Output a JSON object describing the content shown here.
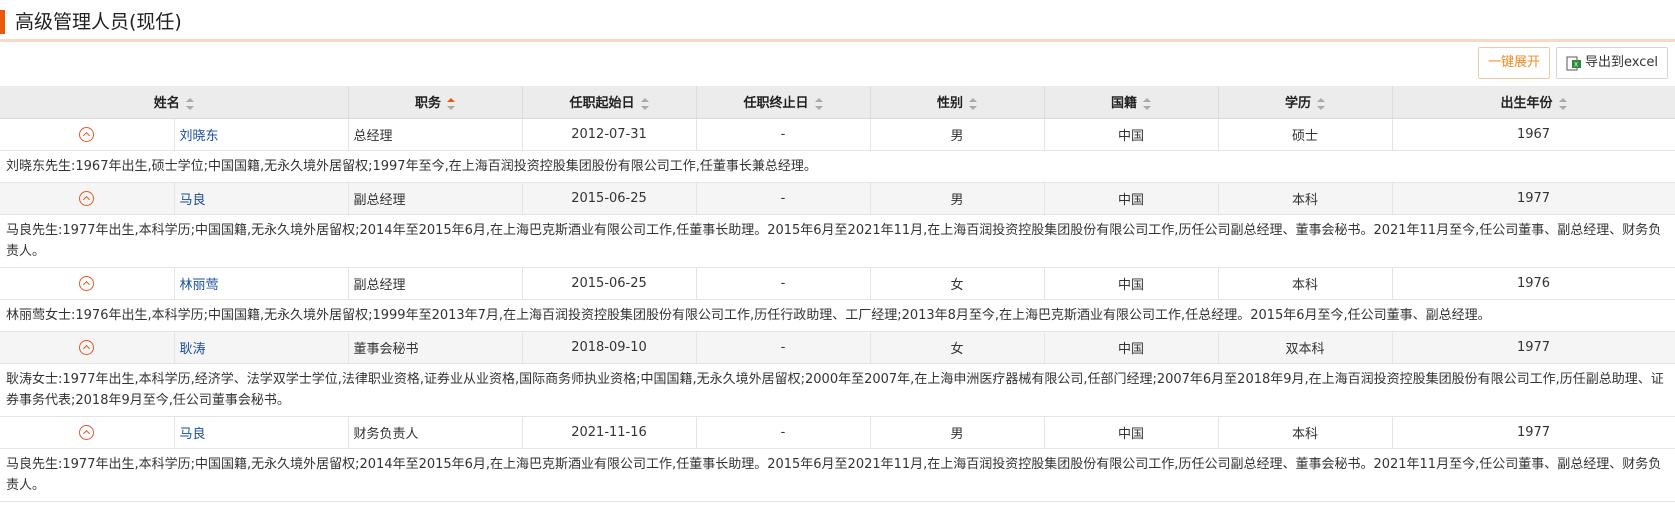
{
  "header": {
    "title": "高级管理人员(现任)"
  },
  "toolbar": {
    "expand_label": "一键展开",
    "export_label": "导出到excel"
  },
  "table": {
    "columns": [
      "姓名",
      "职务",
      "任职起始日",
      "任职终止日",
      "性别",
      "国籍",
      "学历",
      "出生年份"
    ],
    "sorted_column": "职务",
    "rows": [
      {
        "name": "刘晓东",
        "position": "总经理",
        "start": "2012-07-31",
        "end": "-",
        "gender": "男",
        "nationality": "中国",
        "education": "硕士",
        "birth_year": "1967",
        "bio": "刘晓东先生:1967年出生,硕士学位;中国国籍,无永久境外居留权;1997年至今,在上海百润投资控股集团股份有限公司工作,任董事长兼总经理。"
      },
      {
        "name": "马良",
        "position": "副总经理",
        "start": "2015-06-25",
        "end": "-",
        "gender": "男",
        "nationality": "中国",
        "education": "本科",
        "birth_year": "1977",
        "bio": "马良先生:1977年出生,本科学历;中国国籍,无永久境外居留权;2014年至2015年6月,在上海巴克斯酒业有限公司工作,任董事长助理。2015年6月至2021年11月,在上海百润投资控股集团股份有限公司工作,历任公司副总经理、董事会秘书。2021年11月至今,任公司董事、副总经理、财务负责人。"
      },
      {
        "name": "林丽莺",
        "position": "副总经理",
        "start": "2015-06-25",
        "end": "-",
        "gender": "女",
        "nationality": "中国",
        "education": "本科",
        "birth_year": "1976",
        "bio": "林丽莺女士:1976年出生,本科学历;中国国籍,无永久境外居留权;1999年至2013年7月,在上海百润投资控股集团股份有限公司工作,历任行政助理、工厂经理;2013年8月至今,在上海巴克斯酒业有限公司工作,任总经理。2015年6月至今,任公司董事、副总经理。"
      },
      {
        "name": "耿涛",
        "position": "董事会秘书",
        "start": "2018-09-10",
        "end": "-",
        "gender": "女",
        "nationality": "中国",
        "education": "双本科",
        "birth_year": "1977",
        "bio": "耿涛女士:1977年出生,本科学历,经济学、法学双学士学位,法律职业资格,证券业从业资格,国际商务师执业资格;中国国籍,无永久境外居留权;2000年至2007年,在上海申洲医疗器械有限公司,任部门经理;2007年6月至2018年9月,在上海百润投资控股集团股份有限公司工作,历任副总助理、证券事务代表;2018年9月至今,任公司董事会秘书。"
      },
      {
        "name": "马良",
        "position": "财务负责人",
        "start": "2021-11-16",
        "end": "-",
        "gender": "男",
        "nationality": "中国",
        "education": "本科",
        "birth_year": "1977",
        "bio": "马良先生:1977年出生,本科学历;中国国籍,无永久境外居留权;2014年至2015年6月,在上海巴克斯酒业有限公司工作,任董事长助理。2015年6月至2021年11月,在上海百润投资控股集团股份有限公司工作,历任公司副总经理、董事会秘书。2021年11月至今,任公司董事、副总经理、财务负责人。"
      }
    ]
  },
  "colors": {
    "accent": "#e8590c",
    "name_link": "#1a4e9c",
    "expand_text": "#f08a24"
  }
}
